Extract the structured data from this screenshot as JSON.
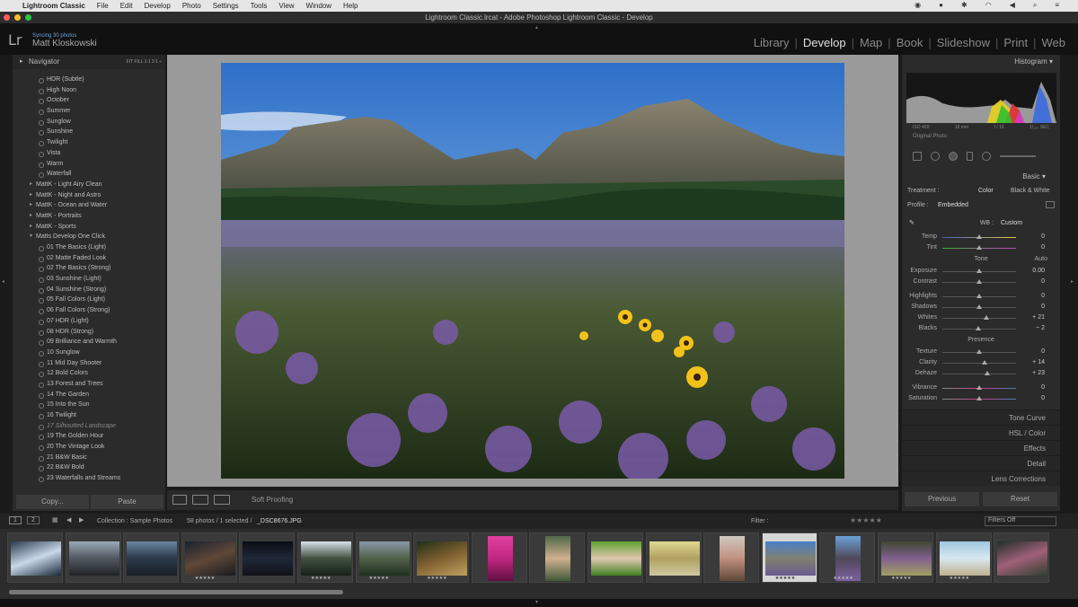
{
  "menubar": {
    "apple": "",
    "items": [
      "Lightroom Classic",
      "File",
      "Edit",
      "Develop",
      "Photo",
      "Settings",
      "Tools",
      "View",
      "Window",
      "Help"
    ]
  },
  "window": {
    "title": "Lightroom Classic.lrcat - Adobe Photoshop Lightroom Classic - Develop"
  },
  "identity": {
    "logo": "Lr",
    "sync_status": "Syncing 30 photos",
    "user": "Matt Kloskowski"
  },
  "modules": [
    "Library",
    "Develop",
    "Map",
    "Book",
    "Slideshow",
    "Print",
    "Web"
  ],
  "active_module": "Develop",
  "navigator": {
    "title": "Navigator",
    "options": "FIT   FILL   1:1   2:1 ÷"
  },
  "presets": [
    {
      "label": "HDR (Subtle)",
      "kind": "item"
    },
    {
      "label": "High Noon",
      "kind": "item"
    },
    {
      "label": "October",
      "kind": "item"
    },
    {
      "label": "Summer",
      "kind": "item"
    },
    {
      "label": "Sunglow",
      "kind": "item"
    },
    {
      "label": "Sunshine",
      "kind": "item"
    },
    {
      "label": "Twilight",
      "kind": "item"
    },
    {
      "label": "Vista",
      "kind": "item"
    },
    {
      "label": "Warm",
      "kind": "item"
    },
    {
      "label": "Waterfall",
      "kind": "item"
    },
    {
      "label": "MattK - Light Airy Clean",
      "kind": "folder"
    },
    {
      "label": "MattK - Night and Astro",
      "kind": "folder"
    },
    {
      "label": "MattK - Ocean and Water",
      "kind": "folder"
    },
    {
      "label": "MattK - Portraits",
      "kind": "folder"
    },
    {
      "label": "MattK - Sports",
      "kind": "folder"
    },
    {
      "label": "Matts Develop One Click",
      "kind": "folder open"
    },
    {
      "label": "01 The Basics (Light)",
      "kind": "item"
    },
    {
      "label": "02 Matte Faded Look",
      "kind": "item"
    },
    {
      "label": "02 The Basics (Strong)",
      "kind": "item"
    },
    {
      "label": "03 Sunshine (Light)",
      "kind": "item"
    },
    {
      "label": "04 Sunshine (Strong)",
      "kind": "item"
    },
    {
      "label": "05 Fall Colors (Light)",
      "kind": "item"
    },
    {
      "label": "06 Fall Colors (Strong)",
      "kind": "item"
    },
    {
      "label": "07 HDR (Light)",
      "kind": "item"
    },
    {
      "label": "08 HDR (Strong)",
      "kind": "item"
    },
    {
      "label": "09 Brilliance and Warmth",
      "kind": "item"
    },
    {
      "label": "10 Sunglow",
      "kind": "item"
    },
    {
      "label": "11 Mid Day Shooter",
      "kind": "item"
    },
    {
      "label": "12 Bold Colors",
      "kind": "item"
    },
    {
      "label": "13 Forest and Trees",
      "kind": "item"
    },
    {
      "label": "14 The Garden",
      "kind": "item"
    },
    {
      "label": "15 Into the Sun",
      "kind": "item"
    },
    {
      "label": "16 Twilight",
      "kind": "item"
    },
    {
      "label": "17 Silhoutted Landscape",
      "kind": "item italic"
    },
    {
      "label": "19 The Golden Hour",
      "kind": "item"
    },
    {
      "label": "20 The Vintage Look",
      "kind": "item"
    },
    {
      "label": "21 B&W Basic",
      "kind": "item"
    },
    {
      "label": "22 B&W Bold",
      "kind": "item"
    },
    {
      "label": "23 Waterfalls and Streams",
      "kind": "item"
    }
  ],
  "left_buttons": {
    "copy": "Copy...",
    "paste": "Paste"
  },
  "toolbar": {
    "soft_proofing": "Soft Proofing"
  },
  "histogram": {
    "title": "Histogram",
    "iso": "ISO 400",
    "focal": "16 mm",
    "aperture": "f / 16",
    "shutter": "1/₂₅₀ SEC",
    "original": "Original Photo"
  },
  "basic": {
    "title": "Basic",
    "treatment_label": "Treatment :",
    "treatment_color": "Color",
    "treatment_bw": "Black & White",
    "profile_label": "Profile :",
    "profile_value": "Embedded",
    "wb_label": "WB :",
    "wb_value": "Custom",
    "tone_label": "Tone",
    "auto_label": "Auto",
    "presence_label": "Presence",
    "sliders": [
      {
        "label": "Temp",
        "value": "0",
        "pos": 0.5,
        "color": "temp"
      },
      {
        "label": "Tint",
        "value": "0",
        "pos": 0.5,
        "color": "tint"
      },
      {
        "label": "Exposure",
        "value": "0.00",
        "pos": 0.5
      },
      {
        "label": "Contrast",
        "value": "0",
        "pos": 0.5
      },
      {
        "label": "Highlights",
        "value": "0",
        "pos": 0.5
      },
      {
        "label": "Shadows",
        "value": "0",
        "pos": 0.5
      },
      {
        "label": "Whites",
        "value": "+ 21",
        "pos": 0.6
      },
      {
        "label": "Blacks",
        "value": "− 2",
        "pos": 0.49
      },
      {
        "label": "Texture",
        "value": "0",
        "pos": 0.5
      },
      {
        "label": "Clarity",
        "value": "+ 14",
        "pos": 0.57
      },
      {
        "label": "Dehaze",
        "value": "+ 23",
        "pos": 0.61
      },
      {
        "label": "Vibrance",
        "value": "0",
        "pos": 0.5,
        "color": "vib"
      },
      {
        "label": "Saturation",
        "value": "0",
        "pos": 0.5,
        "color": "vib"
      }
    ]
  },
  "collapsed_panels": [
    "Tone Curve",
    "HSL / Color",
    "Effects",
    "Detail",
    "Lens Corrections"
  ],
  "right_buttons": {
    "previous": "Previous",
    "reset": "Reset"
  },
  "filmbar": {
    "page1": "1",
    "page2": "2",
    "collection": "Collection : Sample Photos",
    "count": "58 photos / 1 selected /",
    "filename": "_DSC8676.JPG",
    "filter_label": "Filter :",
    "filters_off": "Filters Off"
  },
  "colors": {
    "accent": "#6aa3d8",
    "panel": "#2b2b2b",
    "background": "#1a1a1a"
  },
  "thumbnails": [
    {
      "kind": "water",
      "stars": ""
    },
    {
      "kind": "seascape",
      "stars": ""
    },
    {
      "kind": "sea",
      "stars": ""
    },
    {
      "kind": "night",
      "stars": "★★★★★"
    },
    {
      "kind": "dark",
      "stars": ""
    },
    {
      "kind": "lake",
      "stars": "★★★★★"
    },
    {
      "kind": "mtn",
      "stars": "★★★★★"
    },
    {
      "kind": "fall",
      "stars": "★★★★★"
    },
    {
      "kind": "pink",
      "stars": "",
      "portrait": true
    },
    {
      "kind": "girl",
      "stars": "",
      "portrait": true
    },
    {
      "kind": "green",
      "stars": ""
    },
    {
      "kind": "yellow",
      "stars": ""
    },
    {
      "kind": "woman",
      "stars": "",
      "portrait": true
    },
    {
      "kind": "meadow",
      "stars": "★★★★★",
      "selected": true
    },
    {
      "kind": "meadow2",
      "stars": "★★★★★",
      "portrait": true
    },
    {
      "kind": "flowers",
      "stars": "★★★★★"
    },
    {
      "kind": "beach",
      "stars": "★★★★★"
    },
    {
      "kind": "bokeh",
      "stars": ""
    }
  ]
}
